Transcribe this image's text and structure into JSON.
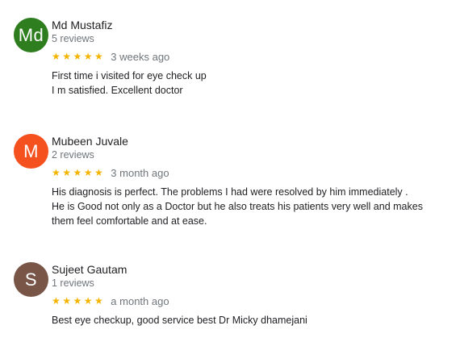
{
  "reviews": [
    {
      "initials": "Md",
      "avatar_color": "#2e7d1f",
      "author": "Md Mustafiz",
      "count": "5 reviews",
      "stars": "★★★★★",
      "date": "3 weeks ago",
      "lines": [
        "First time i visited for eye check up",
        "I m satisfied. Excellent doctor"
      ]
    },
    {
      "initials": "M",
      "avatar_color": "#f4511e",
      "author": "Mubeen Juvale",
      "count": "2 reviews",
      "stars": "★★★★★",
      "date": "3 month ago",
      "lines": [
        "His diagnosis is perfect. The problems I had were resolved by him immediately .",
        "He is Good not only as a Doctor but he also treats his patients very well and makes",
        "them feel comfortable and at ease."
      ]
    },
    {
      "initials": "S",
      "avatar_color": "#795548",
      "author": "Sujeet Gautam",
      "count": "1 reviews",
      "stars": "★★★★★",
      "date": "a month ago",
      "lines": [
        "Best eye checkup, good service best Dr Micky dhamejani"
      ]
    }
  ],
  "colors": {
    "star": "#f4b400",
    "secondary_text": "#70757a",
    "primary_text": "#202124"
  }
}
